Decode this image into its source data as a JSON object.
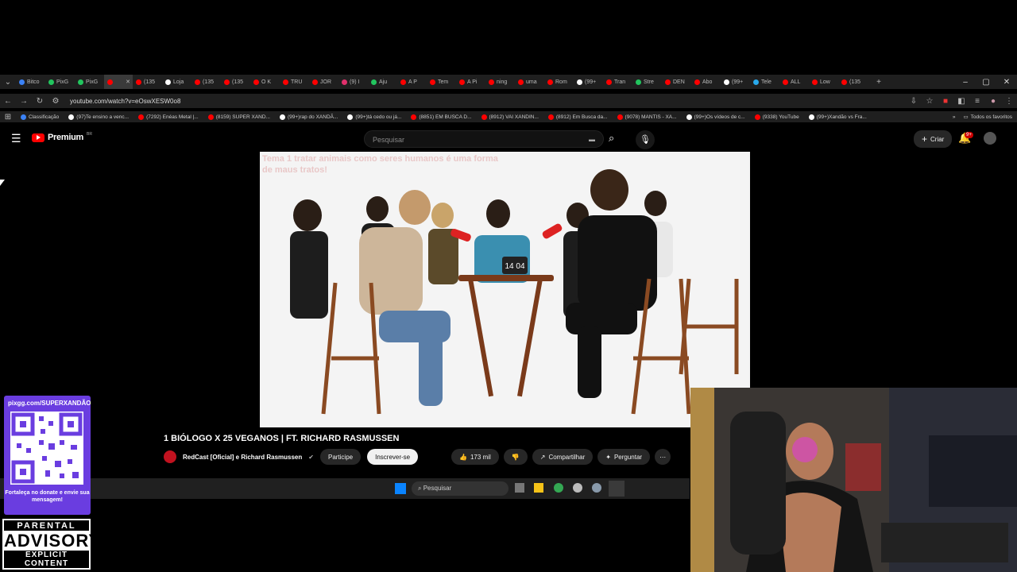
{
  "browser": {
    "tabs": [
      {
        "label": "Bitco",
        "color": "#3b82f6"
      },
      {
        "label": "PixG",
        "color": "#22c55e"
      },
      {
        "label": "PixG",
        "color": "#22c55e"
      },
      {
        "label": "",
        "color": "#ff0000",
        "active": true
      },
      {
        "label": "(135",
        "color": "#ff0000"
      },
      {
        "label": "Loja",
        "color": "#ffffff"
      },
      {
        "label": "(135",
        "color": "#ff0000"
      },
      {
        "label": "(135",
        "color": "#ff0000"
      },
      {
        "label": "O K",
        "color": "#ff0000"
      },
      {
        "label": "TRU",
        "color": "#ff0000"
      },
      {
        "label": "JOR",
        "color": "#ff0000"
      },
      {
        "label": "(9) I",
        "color": "#e1306c"
      },
      {
        "label": "Aju",
        "color": "#22c55e"
      },
      {
        "label": "A P",
        "color": "#ff0000"
      },
      {
        "label": "Tem",
        "color": "#ff0000"
      },
      {
        "label": "A Pi",
        "color": "#ff0000"
      },
      {
        "label": "ning",
        "color": "#ff0000"
      },
      {
        "label": "uma",
        "color": "#ff0000"
      },
      {
        "label": "Rom",
        "color": "#ff0000"
      },
      {
        "label": "(99+",
        "color": "#ffffff"
      },
      {
        "label": "Tran",
        "color": "#ff0000"
      },
      {
        "label": "Stre",
        "color": "#22c55e"
      },
      {
        "label": "DEN",
        "color": "#ff0000"
      },
      {
        "label": "Abo",
        "color": "#ff0000"
      },
      {
        "label": "(99+",
        "color": "#ffffff"
      },
      {
        "label": "Tele",
        "color": "#29a9eb"
      },
      {
        "label": "ALL",
        "color": "#ff0000"
      },
      {
        "label": "Low",
        "color": "#ff0000"
      },
      {
        "label": "(135",
        "color": "#ff0000"
      }
    ],
    "url": "youtube.com/watch?v=eOswXESW0o8",
    "bookmarks": [
      "Classificação",
      "(97)Te ensino a venc...",
      "(7292) Enéas Metal |...",
      "(8159) SUPER XAND...",
      "(99+)rap do XANDÃ...",
      "(99+)tá cedo ou já...",
      "(8851) EM BUSCA D...",
      "(8912) VAI XANDIN...",
      "(8912) Em Busca da...",
      "(9078) MANTIS - XA...",
      "(99+)Os vídeos de c...",
      "(9338) YouTube",
      "(99+)Xandão vs Fra..."
    ],
    "all_favorites": "Todos os favoritos"
  },
  "youtube": {
    "logo": "Premium",
    "logo_suffix": "BR",
    "search_placeholder": "Pesquisar",
    "create_label": "Criar",
    "notif_badge": "9+"
  },
  "video": {
    "topic_text": "Tema  1  tratar animais como seres humanos é uma forma de maus tratos!",
    "timer": "14 04",
    "title": "1 BIÓLOGO X 25 VEGANOS | FT. RICHARD RASMUSSEN",
    "channel": "RedCast [Oficial] e Richard Rasmussen",
    "join_label": "Participe",
    "subscribe_label": "Inscrever-se",
    "likes": "173 mil",
    "share_label": "Compartilhar",
    "ask_label": "Perguntar"
  },
  "taskbar": {
    "search_placeholder": "Pesquisar"
  },
  "overlay": {
    "qr_url": "pixgg.com/SUPERXANDÃO",
    "qr_message": "Fortaleça no donate e envie sua mensagem!",
    "advisory_top": "PARENTAL",
    "advisory_mid": "ADVISORY",
    "advisory_bottom": "EXPLICIT CONTENT"
  }
}
